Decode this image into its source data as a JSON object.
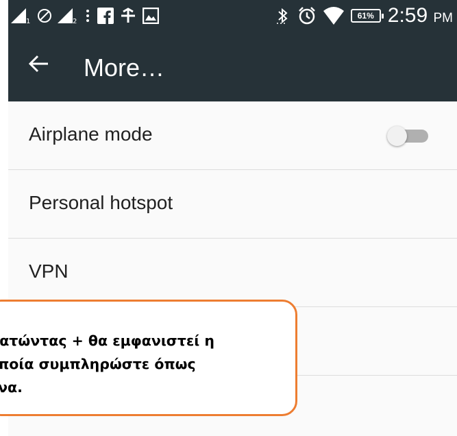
{
  "statusbar": {
    "time": "2:59",
    "ampm": "PM",
    "battery": "61%",
    "left_icons": [
      "signal-icon",
      "blocked-icon",
      "signal-icon",
      "more-vert-icon",
      "facebook-icon",
      "chat-icon",
      "image-icon"
    ],
    "right_icons": [
      "bluetooth-icon",
      "alarm-icon",
      "wifi-icon",
      "battery-icon"
    ]
  },
  "appbar": {
    "back_icon": "arrow-left-icon",
    "title": "More…"
  },
  "settings": {
    "items": [
      {
        "label": "Airplane mode",
        "toggle": false
      },
      {
        "label": "Personal hotspot"
      },
      {
        "label": "VPN"
      },
      {
        "label": ""
      }
    ]
  },
  "callout": {
    "text": "πατώντας + θα εμφανιστεί η\nοποία συμπληρώστε όπως\nόνα."
  },
  "colors": {
    "appbar_bg": "#263238",
    "callout_border": "#ed7d31",
    "list_bg": "#fafafa"
  }
}
